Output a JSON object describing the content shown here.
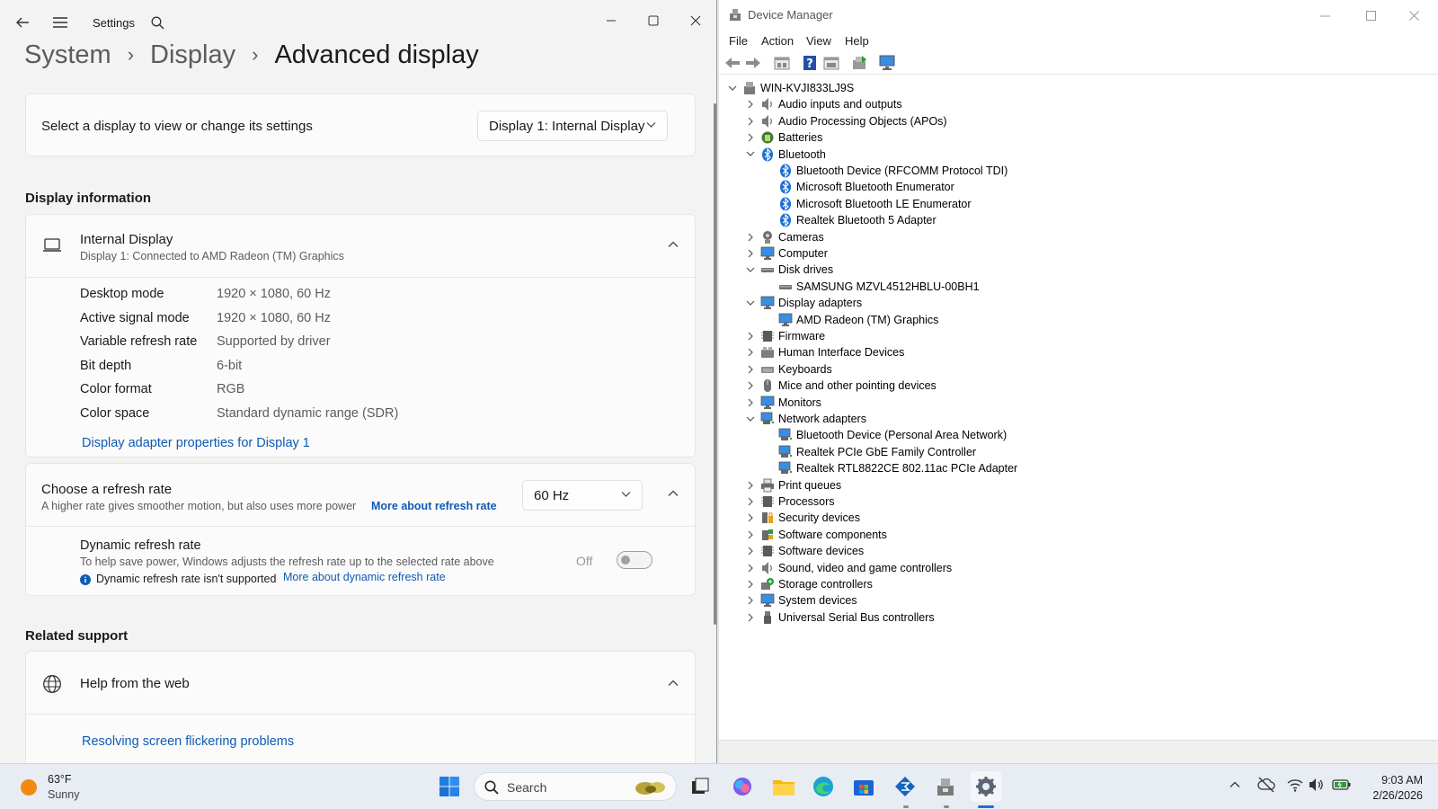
{
  "settings": {
    "title": "Settings",
    "breadcrumb": [
      "System",
      "Display",
      "Advanced display"
    ],
    "select_display": {
      "label": "Select a display to view or change its settings",
      "value": "Display 1: Internal Display"
    },
    "display_info": {
      "heading": "Display information",
      "name": "Internal Display",
      "subtitle": "Display 1: Connected to AMD Radeon (TM) Graphics",
      "rows": [
        {
          "key": "Desktop mode",
          "value": "1920 × 1080, 60 Hz"
        },
        {
          "key": "Active signal mode",
          "value": "1920 × 1080, 60 Hz"
        },
        {
          "key": "Variable refresh rate",
          "value": "Supported by driver"
        },
        {
          "key": "Bit depth",
          "value": "6-bit"
        },
        {
          "key": "Color format",
          "value": "RGB"
        },
        {
          "key": "Color space",
          "value": "Standard dynamic range (SDR)"
        }
      ],
      "adapter_link": "Display adapter properties for Display 1"
    },
    "refresh": {
      "title": "Choose a refresh rate",
      "subtitle": "A higher rate gives smoother motion, but also uses more power",
      "more_link": "More about refresh rate",
      "value": "60 Hz",
      "dynamic_title": "Dynamic refresh rate",
      "dynamic_desc": "To help save power, Windows adjusts the refresh rate up to the selected rate above",
      "dynamic_note": "Dynamic refresh rate isn't supported",
      "dynamic_link": "More about dynamic refresh rate",
      "toggle_label": "Off"
    },
    "related": {
      "heading": "Related support",
      "help": "Help from the web",
      "link": "Resolving screen flickering problems"
    }
  },
  "device_manager": {
    "title": "Device Manager",
    "menu": [
      "File",
      "Action",
      "View",
      "Help"
    ],
    "root": "WIN-KVJI833LJ9S",
    "tree": [
      {
        "label": "Audio inputs and outputs",
        "level": 1,
        "state": "collapsed",
        "icon": "speaker-icon"
      },
      {
        "label": "Audio Processing Objects (APOs)",
        "level": 1,
        "state": "collapsed",
        "icon": "speaker-icon"
      },
      {
        "label": "Batteries",
        "level": 1,
        "state": "collapsed",
        "icon": "battery-icon"
      },
      {
        "label": "Bluetooth",
        "level": 1,
        "state": "expanded",
        "icon": "bluetooth-icon"
      },
      {
        "label": "Bluetooth Device (RFCOMM Protocol TDI)",
        "level": 2,
        "state": "leaf",
        "icon": "bluetooth-icon"
      },
      {
        "label": "Microsoft Bluetooth Enumerator",
        "level": 2,
        "state": "leaf",
        "icon": "bluetooth-icon"
      },
      {
        "label": "Microsoft Bluetooth LE Enumerator",
        "level": 2,
        "state": "leaf",
        "icon": "bluetooth-icon"
      },
      {
        "label": "Realtek Bluetooth 5 Adapter",
        "level": 2,
        "state": "leaf",
        "icon": "bluetooth-icon"
      },
      {
        "label": "Cameras",
        "level": 1,
        "state": "collapsed",
        "icon": "camera-icon"
      },
      {
        "label": "Computer",
        "level": 1,
        "state": "collapsed",
        "icon": "monitor-icon"
      },
      {
        "label": "Disk drives",
        "level": 1,
        "state": "expanded",
        "icon": "disk-icon"
      },
      {
        "label": "SAMSUNG MZVL4512HBLU-00BH1",
        "level": 2,
        "state": "leaf",
        "icon": "disk-icon"
      },
      {
        "label": "Display adapters",
        "level": 1,
        "state": "expanded",
        "icon": "monitor-icon"
      },
      {
        "label": "AMD Radeon (TM) Graphics",
        "level": 2,
        "state": "leaf",
        "icon": "monitor-icon"
      },
      {
        "label": "Firmware",
        "level": 1,
        "state": "collapsed",
        "icon": "chip-icon"
      },
      {
        "label": "Human Interface Devices",
        "level": 1,
        "state": "collapsed",
        "icon": "hid-icon"
      },
      {
        "label": "Keyboards",
        "level": 1,
        "state": "collapsed",
        "icon": "keyboard-icon"
      },
      {
        "label": "Mice and other pointing devices",
        "level": 1,
        "state": "collapsed",
        "icon": "mouse-icon"
      },
      {
        "label": "Monitors",
        "level": 1,
        "state": "collapsed",
        "icon": "monitor-icon"
      },
      {
        "label": "Network adapters",
        "level": 1,
        "state": "expanded",
        "icon": "network-icon"
      },
      {
        "label": "Bluetooth Device (Personal Area Network)",
        "level": 2,
        "state": "leaf",
        "icon": "network-icon"
      },
      {
        "label": "Realtek PCIe GbE Family Controller",
        "level": 2,
        "state": "leaf",
        "icon": "network-icon"
      },
      {
        "label": "Realtek RTL8822CE 802.11ac PCIe Adapter",
        "level": 2,
        "state": "leaf",
        "icon": "network-icon"
      },
      {
        "label": "Print queues",
        "level": 1,
        "state": "collapsed",
        "icon": "printer-icon"
      },
      {
        "label": "Processors",
        "level": 1,
        "state": "collapsed",
        "icon": "chip-icon"
      },
      {
        "label": "Security devices",
        "level": 1,
        "state": "collapsed",
        "icon": "security-icon"
      },
      {
        "label": "Software components",
        "level": 1,
        "state": "collapsed",
        "icon": "puzzle-icon"
      },
      {
        "label": "Software devices",
        "level": 1,
        "state": "collapsed",
        "icon": "chip-icon"
      },
      {
        "label": "Sound, video and game controllers",
        "level": 1,
        "state": "collapsed",
        "icon": "speaker-icon"
      },
      {
        "label": "Storage controllers",
        "level": 1,
        "state": "collapsed",
        "icon": "storage-icon"
      },
      {
        "label": "System devices",
        "level": 1,
        "state": "collapsed",
        "icon": "monitor-icon"
      },
      {
        "label": "Universal Serial Bus controllers",
        "level": 1,
        "state": "collapsed",
        "icon": "usb-icon"
      }
    ]
  },
  "taskbar": {
    "weather_temp": "63°F",
    "weather_desc": "Sunny",
    "search_label": "Search",
    "time": "9:03 AM",
    "date": "2/26/2026"
  },
  "colors": {
    "accent": "#0f5bb5",
    "settings_bg": "#f3f3f3",
    "card_bg": "#fbfbfb"
  }
}
